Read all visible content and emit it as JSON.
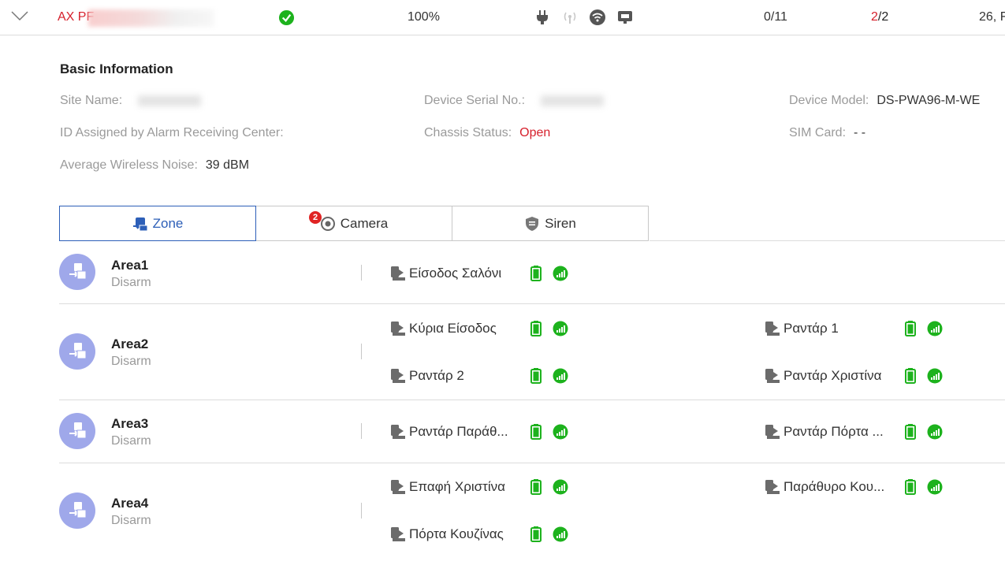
{
  "device": {
    "name_visible": "AX PF",
    "battery_percent": "100%",
    "zones_count": "0/11",
    "areas_prefix": "2",
    "areas_suffix": "/2",
    "truncated": "26, F"
  },
  "basic_info": {
    "title": "Basic Information",
    "site_name_label": "Site Name:",
    "serial_label": "Device Serial No.:",
    "model_label": "Device Model:",
    "model_value": "DS-PWA96-M-WE",
    "arc_id_label": "ID Assigned by Alarm Receiving Center:",
    "chassis_label": "Chassis Status:",
    "chassis_value": "Open",
    "sim_label": "SIM Card:",
    "sim_value": "- -",
    "noise_label": "Average Wireless Noise:",
    "noise_value": "39 dBM"
  },
  "tabs": {
    "zone": "Zone",
    "camera": "Camera",
    "camera_badge": "2",
    "siren": "Siren"
  },
  "areas": [
    {
      "name": "Area1",
      "state": "Disarm",
      "zones": [
        "Είσοδος Σαλόνι"
      ]
    },
    {
      "name": "Area2",
      "state": "Disarm",
      "zones": [
        "Κύρια Είσοδος",
        "Ραντάρ 1",
        "Ραντάρ 2",
        "Ραντάρ Χριστίνα"
      ]
    },
    {
      "name": "Area3",
      "state": "Disarm",
      "zones": [
        "Ραντάρ Παράθ...",
        "Ραντάρ Πόρτα ..."
      ]
    },
    {
      "name": "Area4",
      "state": "Disarm",
      "zones": [
        "Επαφή Χριστίνα",
        "Παράθυρο Κου...",
        "Πόρτα Κουζίνας"
      ]
    }
  ],
  "colors": {
    "accent": "#2d5fb8",
    "alert_red": "#d6202c",
    "ok_green": "#1db21d",
    "avatar_bg": "#9fa8ea",
    "label_gray": "#9a9a9a"
  }
}
